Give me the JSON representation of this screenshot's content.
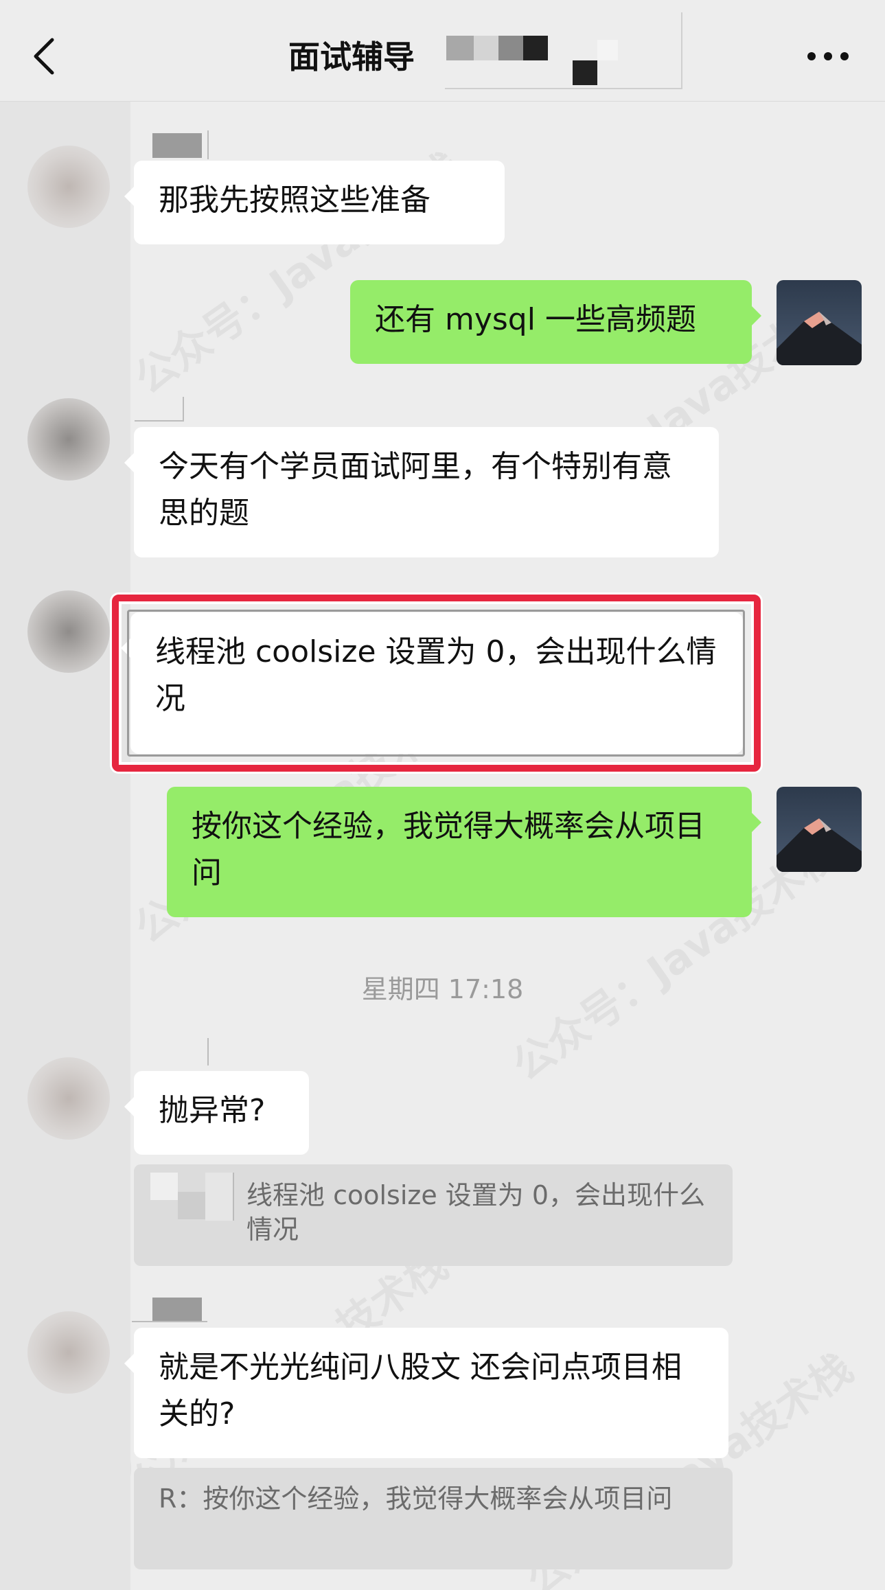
{
  "header": {
    "title": "面试辅导",
    "back_icon": "chevron-left-icon",
    "more_icon": "more-dots-icon"
  },
  "messages": [
    {
      "side": "in",
      "text": "那我先按照这些准备"
    },
    {
      "side": "out",
      "text": "还有 mysql 一些高频题"
    },
    {
      "side": "in",
      "text": "今天有个学员面试阿里，有个特别有意思的题"
    },
    {
      "side": "in",
      "text": "线程池 coolsize 设置为 0，会出现什么情况",
      "highlighted": true
    },
    {
      "side": "out",
      "text": "按你这个经验，我觉得大概率会从项目问"
    },
    {
      "side": "in",
      "text": "抛异常?",
      "quote": "线程池 coolsize 设置为 0，会出现什么情况"
    },
    {
      "side": "in",
      "text": "就是不光光纯问八股文 还会问点项目相关的?",
      "quote": "R：按你这个经验，我觉得大概率会从项目问"
    }
  ],
  "timestamp": "星期四 17:18",
  "watermark": "公众号：Java技术栈",
  "colors": {
    "background": "#ededed",
    "outgoing_bubble": "#95ec69",
    "incoming_bubble": "#ffffff",
    "highlight": "#e6263f"
  }
}
